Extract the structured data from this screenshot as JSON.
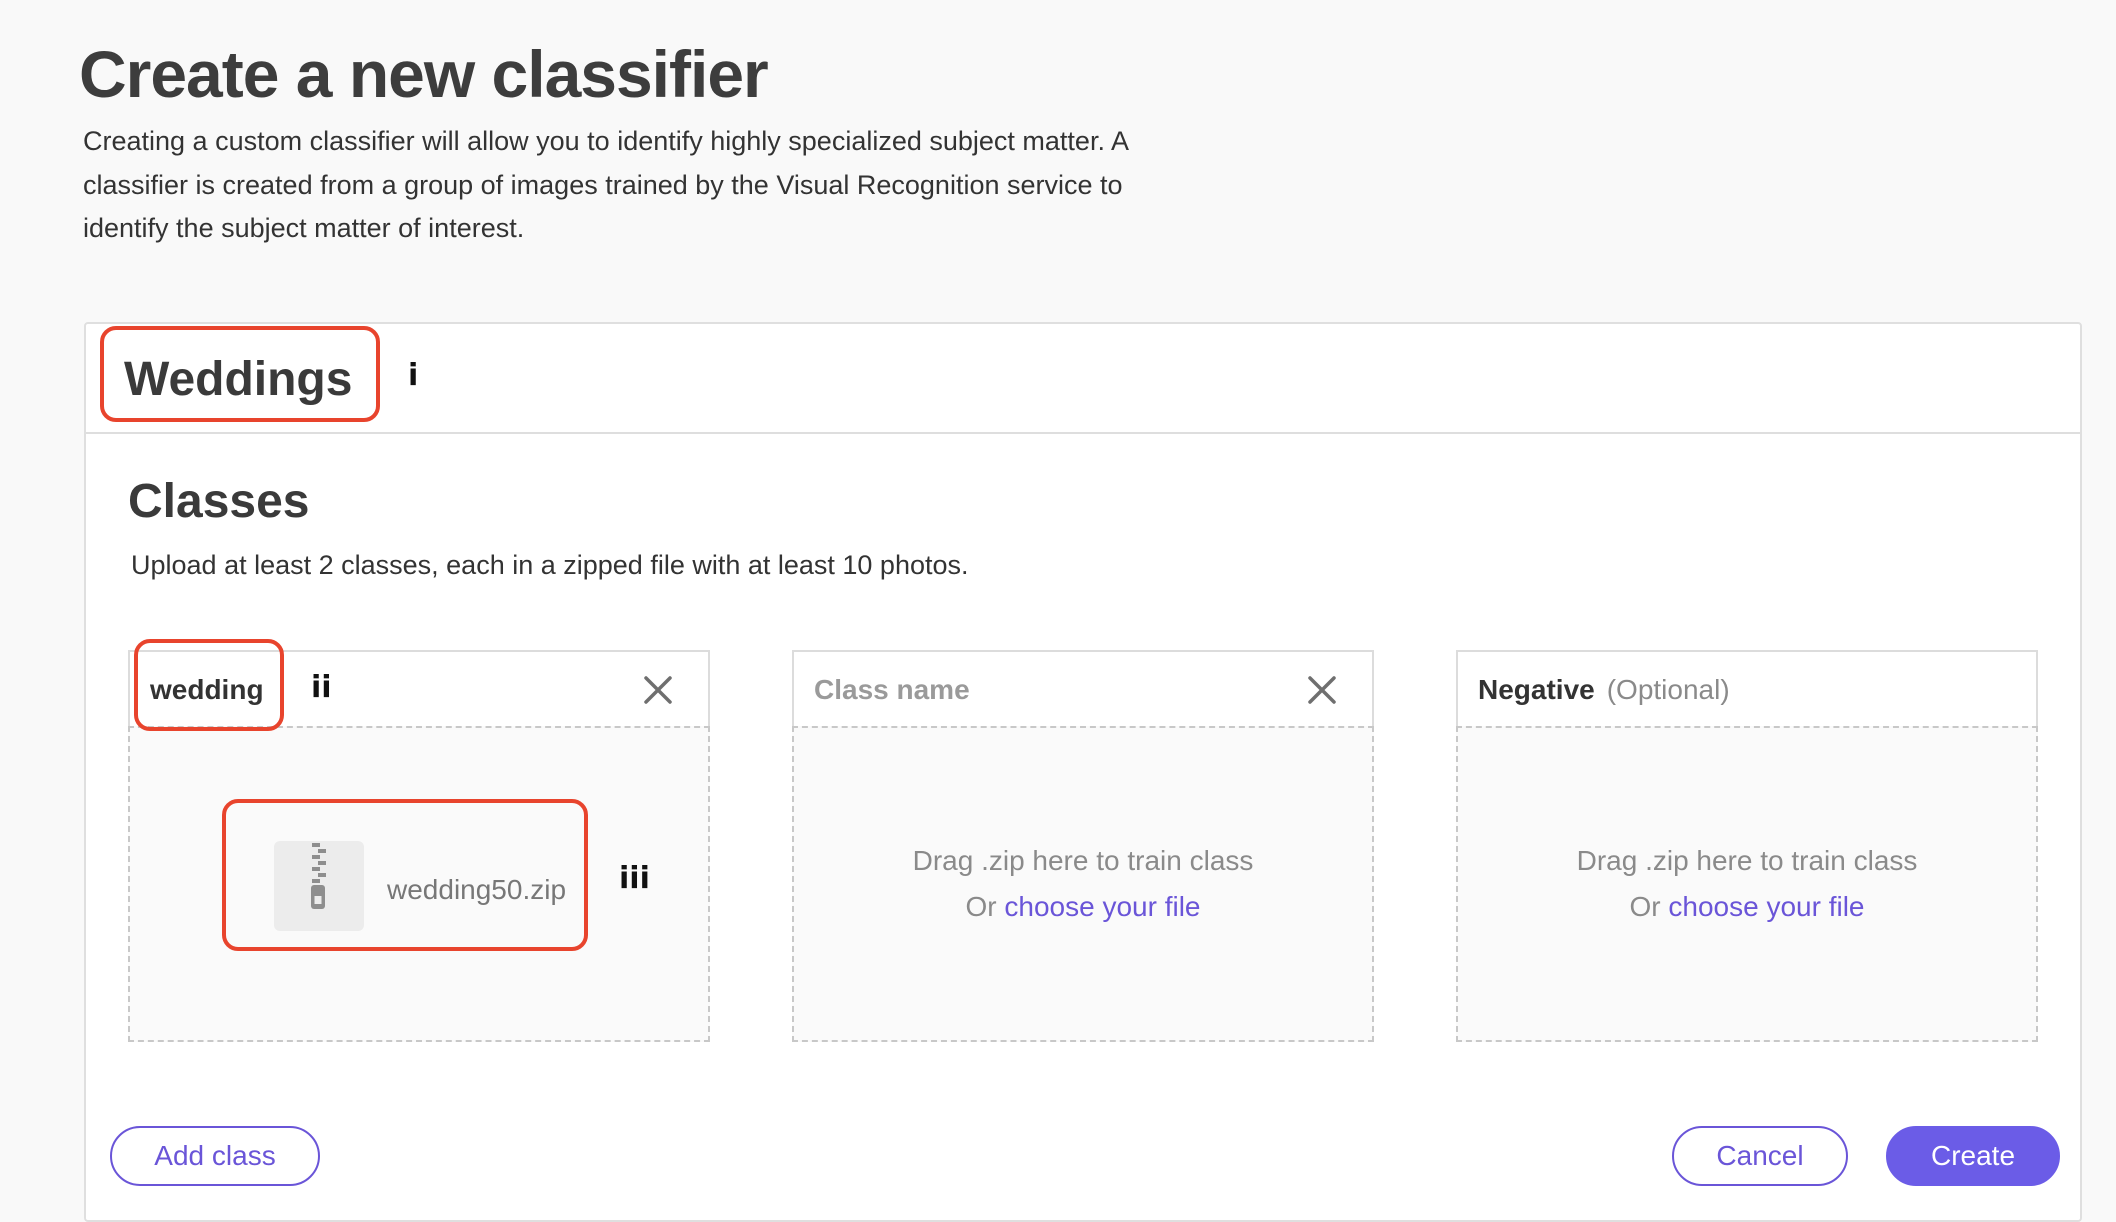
{
  "page": {
    "title": "Create a new classifier",
    "intro_line1": "Creating a custom classifier will allow you to identify highly specialized subject matter. A",
    "intro_line2": "classifier is created from a group of images trained by the Visual Recognition service to",
    "intro_line3": "identify the subject matter of interest."
  },
  "classifier": {
    "name": "Weddings"
  },
  "classes_section": {
    "title": "Classes",
    "description": "Upload at least 2 classes, each in a zipped file with at least 10 photos."
  },
  "classes": [
    {
      "name": "wedding",
      "file": "wedding50.zip"
    },
    {
      "placeholder": "Class name",
      "drop_text": "Drag .zip here to train class",
      "or_text": "Or",
      "link": "choose your file"
    },
    {
      "name": "Negative",
      "optional": "(Optional)",
      "drop_text": "Drag .zip here to train class",
      "or_text": "Or",
      "link": "choose your file"
    }
  ],
  "annotations": {
    "marker_1": "i",
    "marker_2": "ii",
    "marker_3": "iii"
  },
  "buttons": {
    "add_class": "Add class",
    "cancel": "Cancel",
    "create": "Create"
  },
  "colors": {
    "accent": "#6b5ce7",
    "annotation_box": "#e8442d"
  },
  "icons": {
    "remove_class": "close-icon",
    "zip_file": "zip-file-icon"
  }
}
